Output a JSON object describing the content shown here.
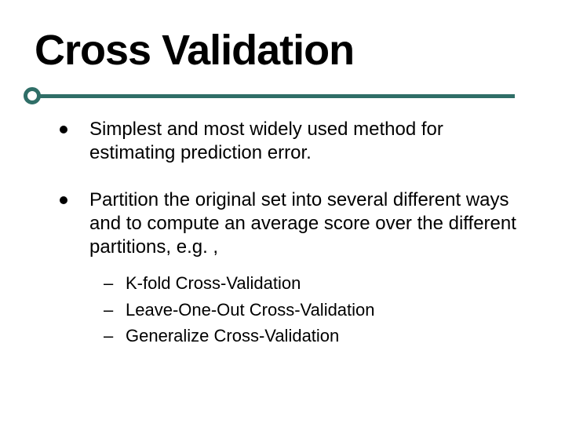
{
  "title": "Cross Validation",
  "bullets": [
    {
      "text": "Simplest and most widely used method for estimating prediction error."
    },
    {
      "text": "Partition the original set into several different ways and to compute an average score over the different partitions, e.g. ,"
    }
  ],
  "sublist": [
    {
      "text": "K-fold Cross-Validation"
    },
    {
      "text": "Leave-One-Out Cross-Validation"
    },
    {
      "text": "Generalize Cross-Validation"
    }
  ]
}
